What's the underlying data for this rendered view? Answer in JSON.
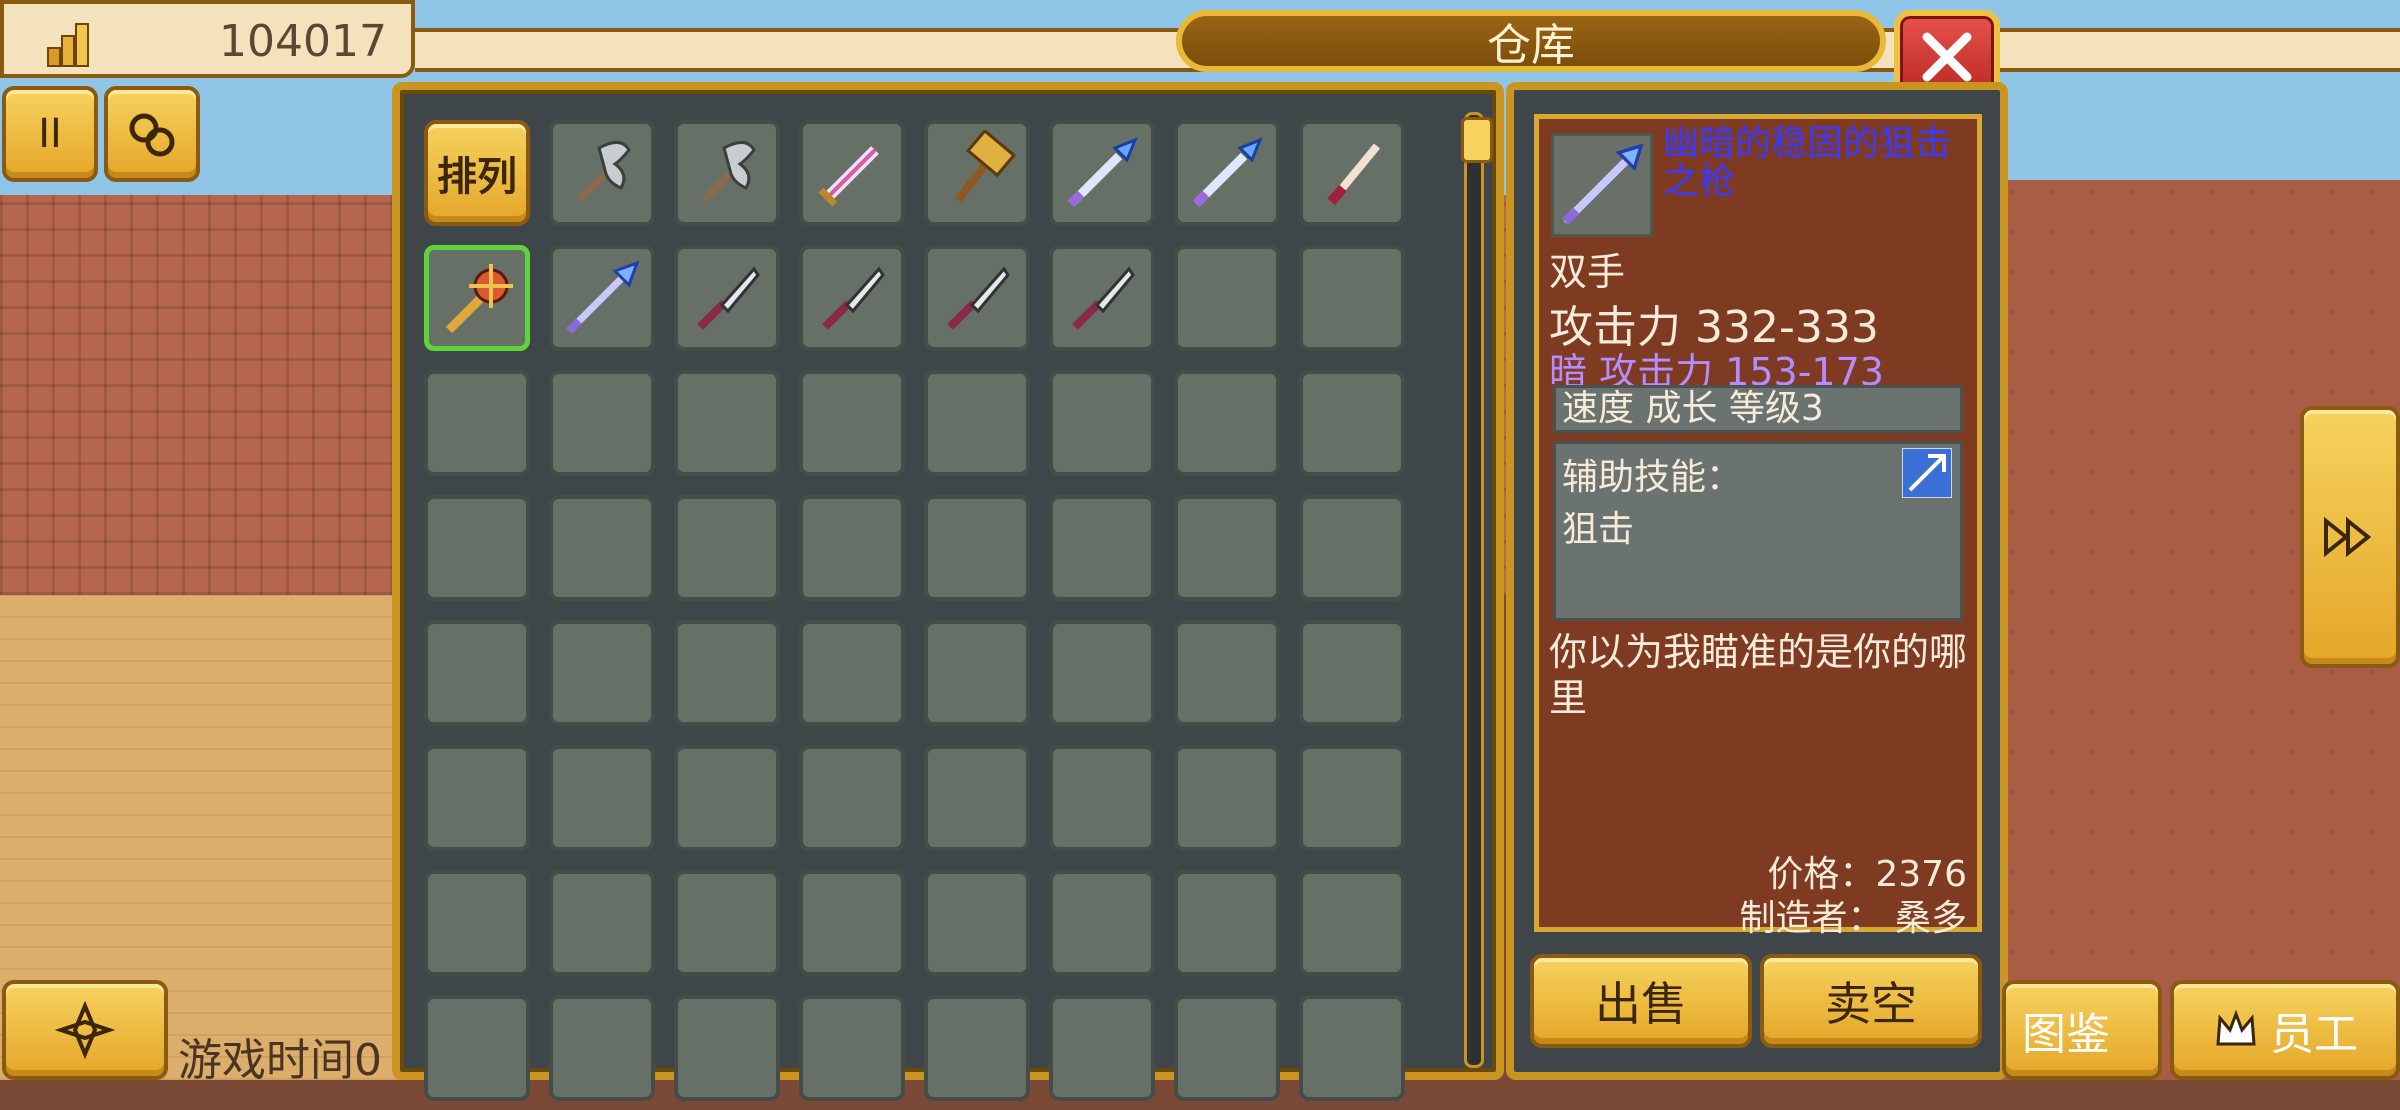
{
  "top_bar": {
    "coins": "104017"
  },
  "storage": {
    "title": "仓库",
    "sort_label": "排列",
    "items": [
      "axe-icon",
      "axe-icon",
      "sword-icon",
      "hammer-icon",
      "crystal-sword-icon",
      "crystal-sword-icon",
      "dagger-icon",
      "mace-icon",
      "crystal-spear-icon",
      "knife-icon",
      "knife-icon",
      "knife-icon",
      "knife-icon"
    ],
    "selected_index": 8
  },
  "detail": {
    "name": "幽暗的稳固的狙击之枪",
    "hands": "双手",
    "attack": "攻击力 332-333",
    "dark_attack": "暗 攻击力 153-173",
    "stats": "速度 成长 等级3",
    "skill_label": "辅助技能：",
    "skill_name": "狙击",
    "description": "你以为我瞄准的是你的哪里",
    "price": "价格：2376",
    "maker": "制造者： 桑多",
    "sell_label": "出售",
    "sell_all_label": "卖空"
  },
  "hud": {
    "pause_label": "II",
    "game_time": "游戏时间0",
    "dex_label": "图鉴",
    "staff_label": "员工"
  },
  "colors": {
    "gold": "#e4a628",
    "panel": "#3f4649",
    "slot": "#677067",
    "selected": "#5fd43a",
    "item_name": "#3a3aff",
    "dark_attack": "#b58cff",
    "close": "#d43a33"
  }
}
